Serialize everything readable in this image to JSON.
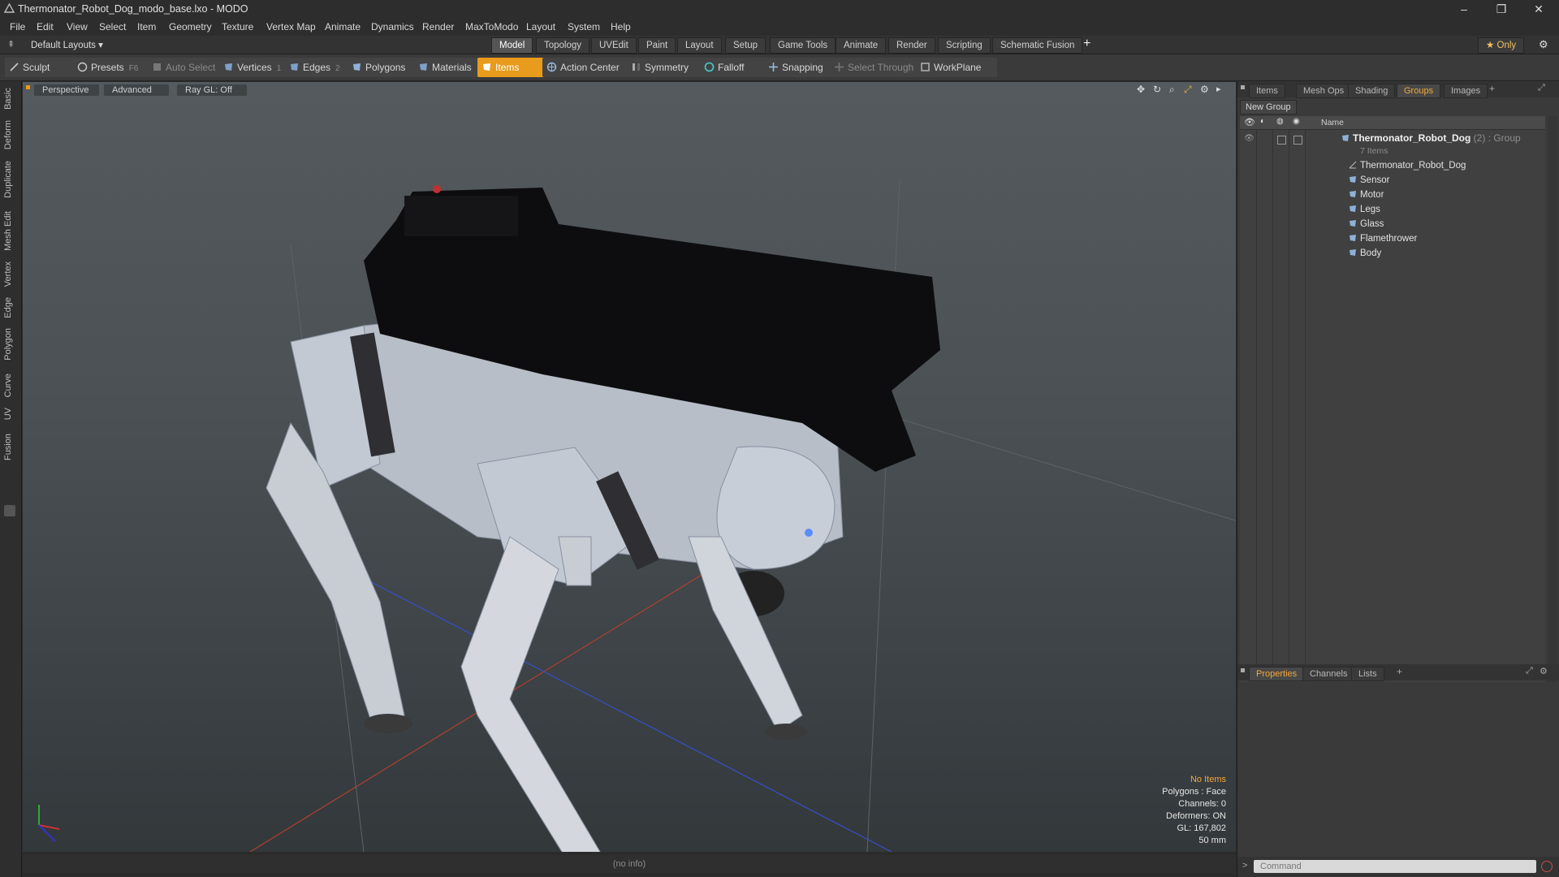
{
  "window": {
    "title": "Thermonator_Robot_Dog_modo_base.lxo - MODO",
    "controls": [
      "–",
      "❐",
      "✕"
    ]
  },
  "menubar": [
    "File",
    "Edit",
    "View",
    "Select",
    "Item",
    "Geometry",
    "Texture",
    "Vertex Map",
    "Animate",
    "Dynamics",
    "Render",
    "MaxToModo",
    "Layout",
    "System",
    "Help"
  ],
  "layoutbar": {
    "layouts_label": "Default Layouts ▾",
    "tabs": [
      "Model",
      "Topology",
      "UVEdit",
      "Paint",
      "Layout",
      "Setup",
      "Game Tools",
      "Animate",
      "Render",
      "Scripting",
      "Schematic Fusion"
    ],
    "active_tab": "Model",
    "add_symbol": "+",
    "only_label": "★ Only"
  },
  "toolbar": {
    "sculpt": "Sculpt",
    "presets": "Presets",
    "presets_key": "F6",
    "auto_select": "Auto Select",
    "vertices": "Vertices",
    "vertices_count": "1",
    "edges": "Edges",
    "edges_count": "2",
    "polygons": "Polygons",
    "materials": "Materials",
    "items": "Items",
    "action_center": "Action Center",
    "symmetry": "Symmetry",
    "falloff": "Falloff",
    "snapping": "Snapping",
    "select_through": "Select Through",
    "workplane": "WorkPlane"
  },
  "left_tabs": [
    "Basic",
    "Deform",
    "Duplicate",
    "Mesh Edit",
    "Vertex",
    "Edge",
    "Polygon",
    "Curve",
    "UV",
    "Fusion"
  ],
  "viewport": {
    "labels": [
      "Perspective",
      "Advanced",
      "Ray GL: Off"
    ],
    "info": {
      "no_items": "No Items",
      "polygons": "Polygons : Face",
      "channels": "Channels: 0",
      "deformers": "Deformers: ON",
      "gl": "GL: 167,802",
      "scale": "50 mm"
    }
  },
  "statusbar": {
    "info": "(no info)"
  },
  "right_panel": {
    "top_tabs": [
      "Items",
      "Mesh Ops",
      "Shading",
      "Groups",
      "Images"
    ],
    "active_top_tab": "Groups",
    "new_group": "New Group",
    "list_header_name": "Name",
    "group": {
      "name": "Thermonator_Robot_Dog",
      "suffix": " (2) : Group",
      "count": "7 Items",
      "children": [
        "Thermonator_Robot_Dog",
        "Sensor",
        "Motor",
        "Legs",
        "Glass",
        "Flamethrower",
        "Body"
      ]
    },
    "bottom_tabs": [
      "Properties",
      "Channels",
      "Lists"
    ],
    "active_bottom_tab": "Properties",
    "command_placeholder": "Command"
  },
  "colors": {
    "accent": "#e89b1c",
    "active_tab_text": "#f2a83a",
    "x_axis": "#c0392b",
    "z_axis": "#3550c8"
  }
}
